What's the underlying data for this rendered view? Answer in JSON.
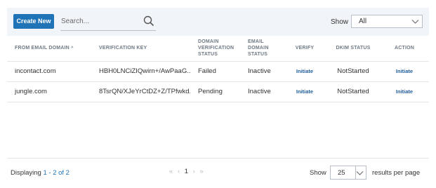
{
  "toolbar": {
    "create_label": "Create New",
    "search_placeholder": "Search...",
    "show_label": "Show",
    "show_value": "All"
  },
  "table": {
    "headers": {
      "from_domain_line1": "FROM EMAIL DOMAIN",
      "from_domain_sort": "^",
      "key": "VERIFICATION KEY",
      "dv_line1": "DOMAIN",
      "dv_line2": "VERIFICATION",
      "dv_line3": "STATUS",
      "ed_line1": "EMAIL",
      "ed_line2": "DOMAIN",
      "ed_line3": "STATUS",
      "verify": "VERIFY",
      "dkim": "DKIM STATUS",
      "action": "ACTION"
    },
    "rows": [
      {
        "domain": "incontact.com",
        "key": "HBH0LNCiZIQwirn+/AwPaaG...",
        "dv_status": "Failed",
        "ed_status": "Inactive",
        "verify": "Initiate",
        "dkim": "NotStarted",
        "action": "Initiate"
      },
      {
        "domain": "jungle.com",
        "key": "8TsrQN/XJeYrCtDZ+Z/TPfwkd...",
        "dv_status": "Pending",
        "ed_status": "Inactive",
        "verify": "Initiate",
        "dkim": "NotStarted",
        "action": "Initiate"
      }
    ]
  },
  "footer": {
    "displaying_prefix": "Displaying ",
    "range": "1 - 2 of 2",
    "pager_first": "«",
    "pager_prev": "‹",
    "current_page": "1",
    "pager_next": "›",
    "pager_last": "»",
    "show_label": "Show",
    "per_page_value": "25",
    "per_page_suffix": "results per page"
  },
  "colors": {
    "accent": "#1f73b7",
    "toolbar_bg": "#f1f4f8",
    "link": "#1f5d99"
  },
  "icons": [
    "search-icon",
    "chevron-down-icon"
  ]
}
